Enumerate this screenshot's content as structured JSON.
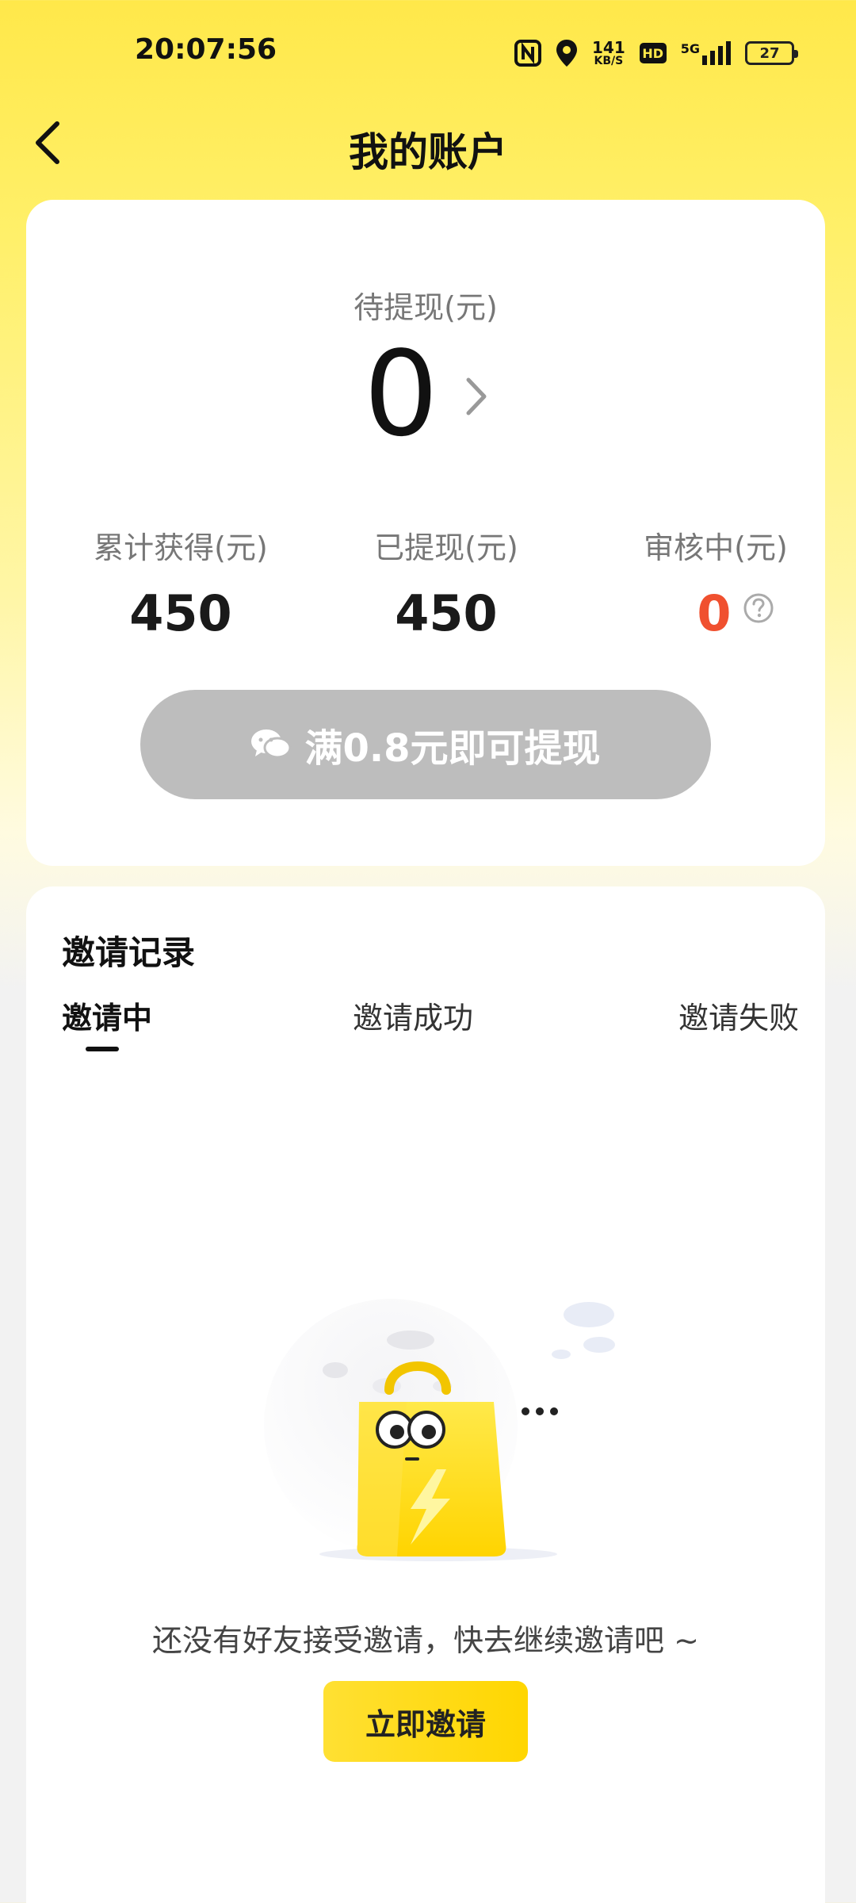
{
  "status_bar": {
    "time": "20:07:56",
    "net_speed_value": "141",
    "net_speed_unit": "KB/S",
    "hd_label": "HD",
    "network_label": "5G",
    "battery": "27"
  },
  "header": {
    "title": "我的账户"
  },
  "balance_card": {
    "pending_label": "待提现(元)",
    "pending_value": "0",
    "stats": [
      {
        "label": "累计获得(元)",
        "value": "450"
      },
      {
        "label": "已提现(元)",
        "value": "450"
      },
      {
        "label": "审核中(元)",
        "value": "0"
      }
    ],
    "withdraw_button_label": "满0.8元即可提现"
  },
  "invite_card": {
    "title": "邀请记录",
    "tabs": [
      "邀请中",
      "邀请成功",
      "邀请失败"
    ],
    "active_tab": "邀请中",
    "empty_message": "还没有好友接受邀请，快去继续邀请吧 ~",
    "invite_button_label": "立即邀请"
  },
  "colors": {
    "accent_yellow": "#FFDD00",
    "audit_value": "#F0502F",
    "disabled_button": "#BDBDBD"
  },
  "icons": [
    "back-icon",
    "chevron-right-icon",
    "question-icon",
    "wechat-icon",
    "nfc-icon",
    "location-icon",
    "signal-icon",
    "battery-icon"
  ]
}
